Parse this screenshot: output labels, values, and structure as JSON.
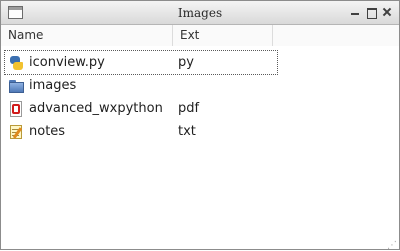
{
  "window": {
    "title": "Images"
  },
  "columns": [
    {
      "label": "Name"
    },
    {
      "label": "Ext"
    }
  ],
  "rows": [
    {
      "name": "iconview.py",
      "ext": "py",
      "icon": "python-file-icon",
      "selected": true
    },
    {
      "name": "images",
      "ext": "",
      "icon": "folder-icon",
      "selected": false
    },
    {
      "name": "advanced_wxpython",
      "ext": "pdf",
      "icon": "pdf-file-icon",
      "selected": false
    },
    {
      "name": "notes",
      "ext": "txt",
      "icon": "text-note-icon",
      "selected": false
    }
  ]
}
